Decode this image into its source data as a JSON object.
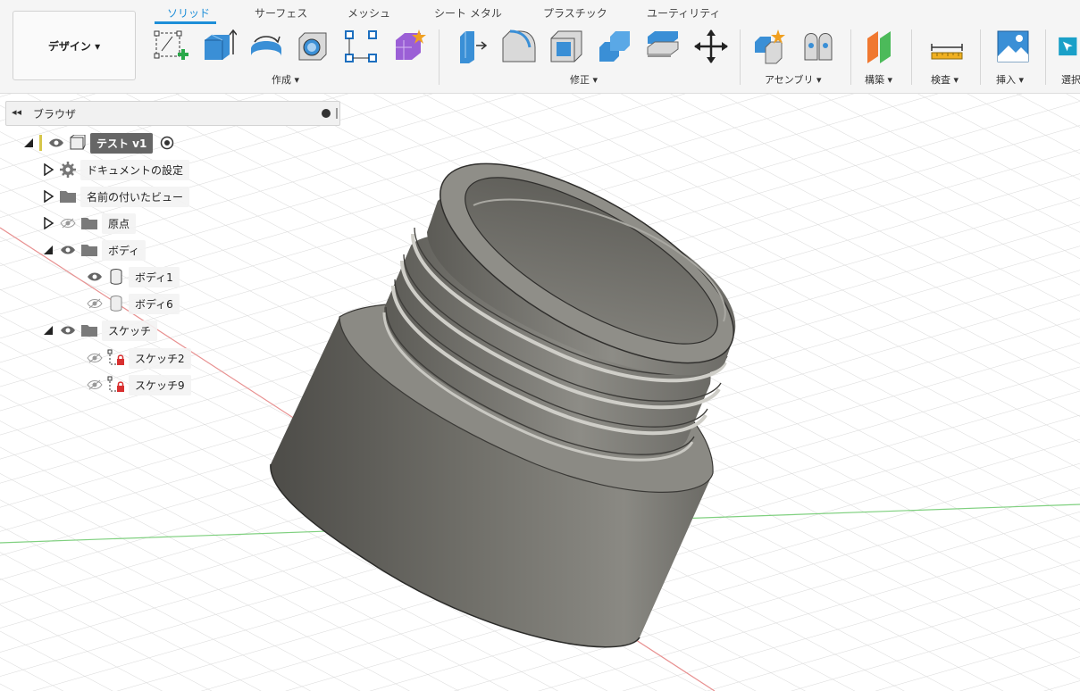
{
  "workspace": {
    "label": "デザイン ▾"
  },
  "tabs": [
    {
      "label": "ソリッド",
      "active": true
    },
    {
      "label": "サーフェス"
    },
    {
      "label": "メッシュ"
    },
    {
      "label": "シート メタル"
    },
    {
      "label": "プラスチック"
    },
    {
      "label": "ユーティリティ"
    }
  ],
  "groups": {
    "create": "作成 ▾",
    "modify": "修正 ▾",
    "assemble": "アセンブリ ▾",
    "construct": "構築 ▾",
    "inspect": "検査 ▾",
    "insert": "挿入 ▾",
    "select": "選択"
  },
  "browser": {
    "title": "ブラウザ",
    "root": "テスト v1",
    "items": {
      "doc_settings": "ドキュメントの設定",
      "named_views": "名前の付いたビュー",
      "origin": "原点",
      "bodies": "ボディ",
      "body1": "ボディ1",
      "body6": "ボディ6",
      "sketches": "スケッチ",
      "sketch2": "スケッチ2",
      "sketch9": "スケッチ9"
    }
  },
  "icons": {
    "create_sketch": "create-sketch-icon",
    "extrude": "extrude-icon",
    "revolve": "revolve-icon",
    "hole": "hole-icon",
    "pattern": "pattern-icon",
    "form": "form-icon",
    "press_pull": "press-pull-icon",
    "fillet": "fillet-icon",
    "shell": "shell-icon",
    "combine": "combine-icon",
    "scale": "scale-icon",
    "move": "move-icon",
    "new_component": "new-component-icon",
    "joint": "joint-icon",
    "offset_plane": "offset-plane-icon",
    "measure": "measure-icon",
    "insert_image": "insert-image-icon",
    "select": "select-icon"
  },
  "colors": {
    "accent": "#1d8ed8",
    "body": "#6e6d67",
    "grid": "#d4d4d4"
  }
}
